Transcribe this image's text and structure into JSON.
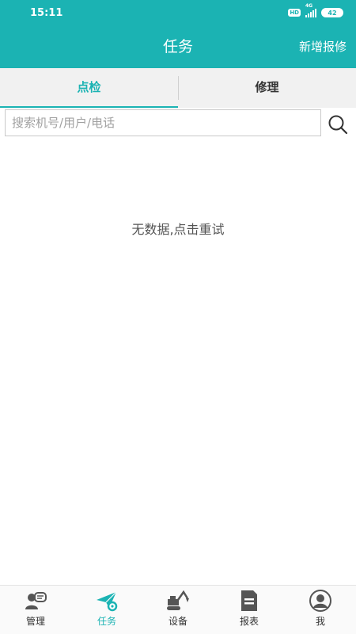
{
  "status_bar": {
    "time": "15:11",
    "hd_label": "HD",
    "network_label": "4G",
    "battery": "42"
  },
  "header": {
    "title": "任务",
    "action_label": "新增报修"
  },
  "tabs": [
    {
      "label": "点检",
      "active": true
    },
    {
      "label": "修理",
      "active": false
    }
  ],
  "search": {
    "placeholder": "搜索机号/用户/电话",
    "value": ""
  },
  "empty_state": {
    "message": "无数据,点击重试"
  },
  "bottom_nav": [
    {
      "label": "管理",
      "icon": "manage-icon",
      "active": false
    },
    {
      "label": "任务",
      "icon": "task-plane-icon",
      "active": true
    },
    {
      "label": "设备",
      "icon": "excavator-icon",
      "active": false
    },
    {
      "label": "报表",
      "icon": "report-icon",
      "active": false
    },
    {
      "label": "我",
      "icon": "profile-icon",
      "active": false
    }
  ],
  "colors": {
    "accent": "#1bb3b3",
    "tab_bg": "#f1f1f1",
    "nav_icon": "#555555"
  }
}
